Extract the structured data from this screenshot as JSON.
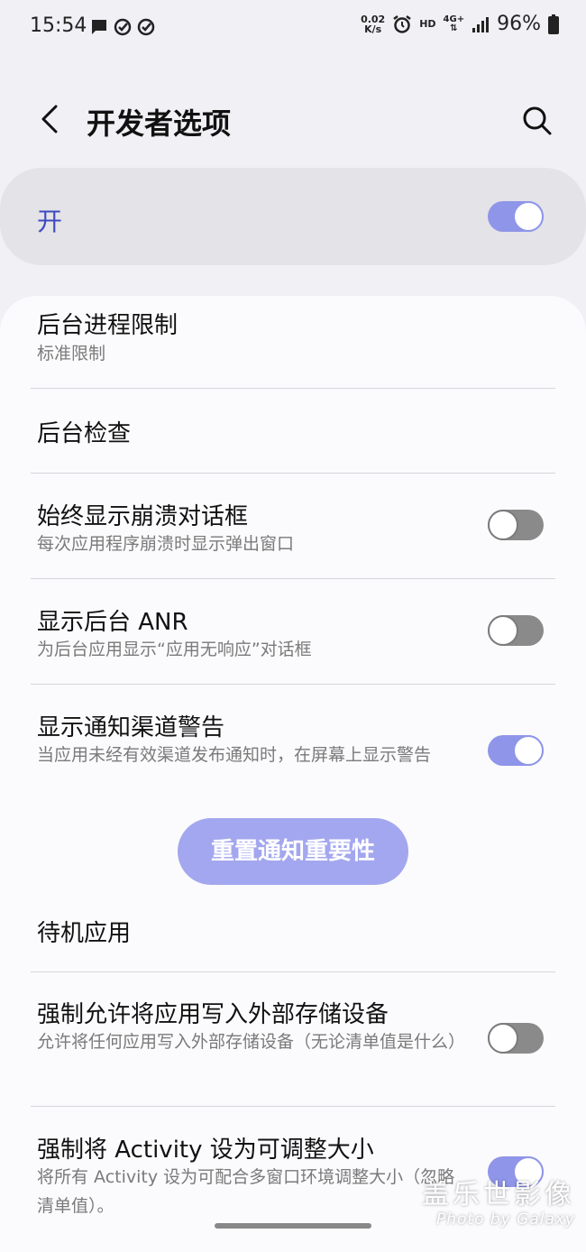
{
  "status_bar": {
    "time": "15:54",
    "net_speed_value": "0.02",
    "net_speed_unit": "K/s",
    "hd": "HD",
    "network": "4G+",
    "battery": "96%",
    "left_icons": [
      "message-icon",
      "check-circle-icon",
      "check-circle-icon"
    ]
  },
  "header": {
    "title": "开发者选项"
  },
  "master": {
    "label": "开",
    "on": true
  },
  "settings": [
    {
      "title": "后台进程限制",
      "subtitle": "标准限制"
    },
    {
      "title": "后台检查"
    },
    {
      "title": "始终显示崩溃对话框",
      "subtitle": "每次应用程序崩溃时显示弹出窗口",
      "on": false
    },
    {
      "title": "显示后台 ANR",
      "subtitle": "为后台应用显示“应用无响应”对话框",
      "on": false
    },
    {
      "title": "显示通知渠道警告",
      "subtitle": "当应用未经有效渠道发布通知时，在屏幕上显示警告",
      "on": true
    },
    {
      "title": "待机应用"
    },
    {
      "title": "强制允许将应用写入外部存储设备",
      "subtitle": "允许将任何应用写入外部存储设备（无论清单值是什么）",
      "on": false
    },
    {
      "title": "强制将 Activity 设为可调整大小",
      "subtitle": "将所有 Activity 设为可配合多窗口环境调整大小（忽略清单值）。",
      "on": true
    }
  ],
  "reset_button": "重置通知重要性",
  "watermark": {
    "line1": "盖乐世影像",
    "line2": "Photo by Galaxy"
  },
  "colors": {
    "accent": "#8f95e8",
    "master_label": "#3e4bc1",
    "button": "#a3a7ef"
  }
}
